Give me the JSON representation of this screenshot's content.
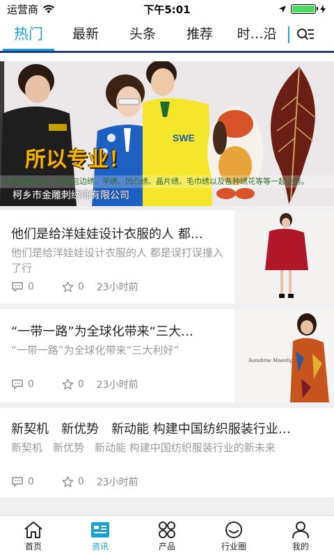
{
  "status_bar": {
    "carrier": "运营商",
    "time": "下午5:01",
    "battery_level": 1.0,
    "battery_color": "#4cd964"
  },
  "tabs": [
    {
      "label": "热门",
      "active": true
    },
    {
      "label": "最新",
      "active": false
    },
    {
      "label": "头条",
      "active": false
    },
    {
      "label": "推荐",
      "active": false
    },
    {
      "label": "时…沿",
      "active": false
    }
  ],
  "banner": {
    "slogan": "所以专业！",
    "caption": "承接对象包括：绣标包边绣、平绣、凹凸绣、晶片绣、毛巾绣以及各种绣花等等一起业务。",
    "company": "柯乡市金雕刺绣饰有限公司"
  },
  "articles": [
    {
      "title": "他们是给洋娃娃设计衣服的人 都…",
      "summary": "他们是给洋娃娃设计衣服的人 都是误打误撞入了行",
      "comments": "0",
      "favorites": "0",
      "time": "23小时前"
    },
    {
      "title": "“一带一路”为全球化带来“三大…",
      "summary": "“一带一路”为全球化带来“三大利好”",
      "comments": "0",
      "favorites": "0",
      "time": "23小时前"
    },
    {
      "title": "新契机　新优势　新动能 构建中国纺织服装行业…",
      "summary": "新契机　新优势　新动能 构建中国纺织服装行业的新未来",
      "comments": "0",
      "favorites": "0",
      "time": "23小时前"
    }
  ],
  "bottom_nav": [
    {
      "label": "首页",
      "icon": "home-icon",
      "active": false
    },
    {
      "label": "资讯",
      "icon": "news-icon",
      "active": true
    },
    {
      "label": "产品",
      "icon": "grid-icon",
      "active": false
    },
    {
      "label": "行业圈",
      "icon": "smile-circle-icon",
      "active": false
    },
    {
      "label": "我的",
      "icon": "person-icon",
      "active": false
    }
  ],
  "colors": {
    "accent": "#19a0d6",
    "tab_underline": "#233a7a"
  }
}
